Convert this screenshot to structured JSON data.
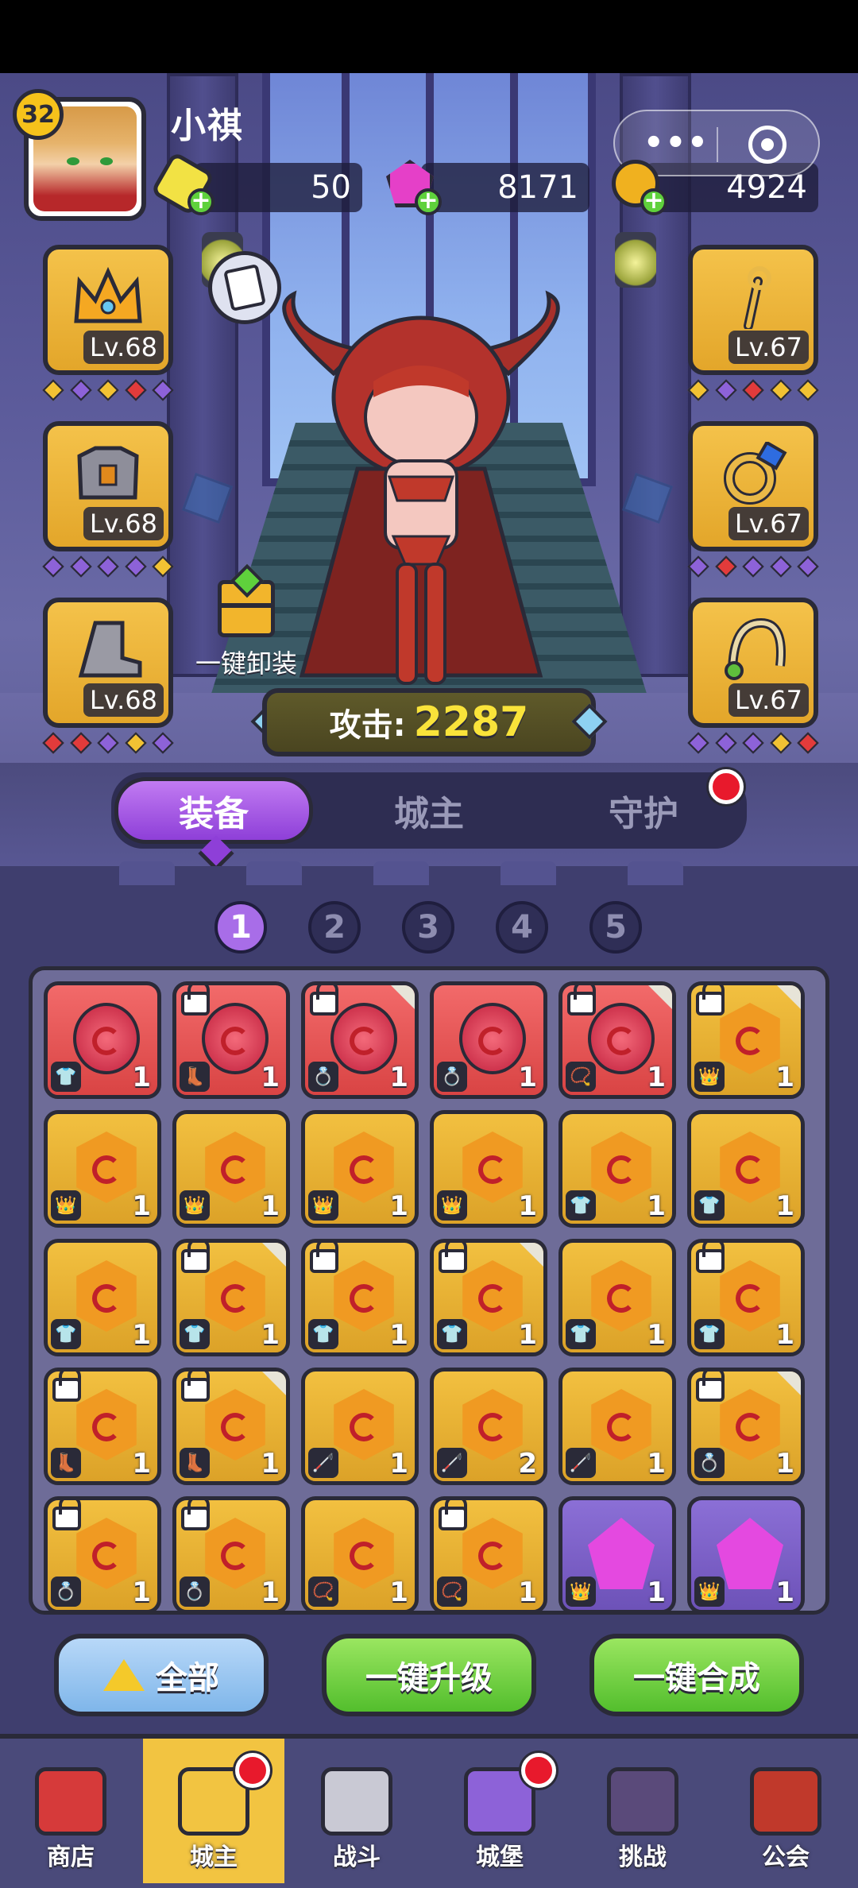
{
  "profile": {
    "level": "32",
    "name": "小祺"
  },
  "currencies": [
    {
      "icon": "gold-gem-icon",
      "value": "50",
      "color": "#f2e244"
    },
    {
      "icon": "pink-diamond-icon",
      "value": "8171",
      "color": "#e540c8"
    },
    {
      "icon": "gold-coin-icon",
      "value": "4924",
      "color": "#f0b11f"
    }
  ],
  "capsule": {
    "more": "•••"
  },
  "equipment_left": [
    {
      "name": "crown",
      "level": "Lv.68",
      "pips": [
        "#f2c233",
        "#8d62d8",
        "#f2c233",
        "#e23b3b",
        "#8d62d8"
      ]
    },
    {
      "name": "armor",
      "level": "Lv.68",
      "pips": [
        "#8d62d8",
        "#8d62d8",
        "#8d62d8",
        "#8d62d8",
        "#f2c233"
      ]
    },
    {
      "name": "boots",
      "level": "Lv.68",
      "pips": [
        "#e23b3b",
        "#e23b3b",
        "#8d62d8",
        "#f2c233",
        "#8d62d8"
      ]
    }
  ],
  "equipment_right": [
    {
      "name": "staff",
      "level": "Lv.67",
      "pips": [
        "#f2c233",
        "#8d62d8",
        "#e23b3b",
        "#f2c233",
        "#f2c233"
      ]
    },
    {
      "name": "ring",
      "level": "Lv.67",
      "pips": [
        "#8d62d8",
        "#e23b3b",
        "#8d62d8",
        "#8d62d8",
        "#8d62d8"
      ]
    },
    {
      "name": "amulet",
      "level": "Lv.67",
      "pips": [
        "#8d62d8",
        "#8d62d8",
        "#8d62d8",
        "#f2c233",
        "#e23b3b"
      ]
    }
  ],
  "unequip_label": "一键卸装",
  "attack": {
    "label": "攻击:",
    "value": "2287"
  },
  "tabs": [
    {
      "label": "装备",
      "active": true
    },
    {
      "label": "城主",
      "active": false
    },
    {
      "label": "守护",
      "active": false
    }
  ],
  "pages": [
    "1",
    "2",
    "3",
    "4",
    "5"
  ],
  "inventory": [
    [
      {
        "bg": "red",
        "gem": "round",
        "type": "👕",
        "qty": "1",
        "lock": false,
        "corner": false
      },
      {
        "bg": "red",
        "gem": "round",
        "type": "👢",
        "qty": "1",
        "lock": true,
        "corner": false
      },
      {
        "bg": "red",
        "gem": "round",
        "type": "💍",
        "qty": "1",
        "lock": true,
        "corner": true
      },
      {
        "bg": "red",
        "gem": "round",
        "type": "💍",
        "qty": "1",
        "lock": false,
        "corner": false
      },
      {
        "bg": "red",
        "gem": "round",
        "type": "📿",
        "qty": "1",
        "lock": true,
        "corner": true
      },
      {
        "bg": "gold",
        "gem": "hex",
        "type": "👑",
        "qty": "1",
        "lock": true,
        "corner": true
      }
    ],
    [
      {
        "bg": "gold",
        "gem": "hex",
        "type": "👑",
        "qty": "1",
        "lock": false,
        "corner": false
      },
      {
        "bg": "gold",
        "gem": "hex",
        "type": "👑",
        "qty": "1",
        "lock": false,
        "corner": false
      },
      {
        "bg": "gold",
        "gem": "hex",
        "type": "👑",
        "qty": "1",
        "lock": false,
        "corner": false
      },
      {
        "bg": "gold",
        "gem": "hex",
        "type": "👑",
        "qty": "1",
        "lock": false,
        "corner": false
      },
      {
        "bg": "gold",
        "gem": "hex",
        "type": "👕",
        "qty": "1",
        "lock": false,
        "corner": false
      },
      {
        "bg": "gold",
        "gem": "hex",
        "type": "👕",
        "qty": "1",
        "lock": false,
        "corner": false
      }
    ],
    [
      {
        "bg": "gold",
        "gem": "hex",
        "type": "👕",
        "qty": "1",
        "lock": false,
        "corner": false
      },
      {
        "bg": "gold",
        "gem": "hex",
        "type": "👕",
        "qty": "1",
        "lock": true,
        "corner": true
      },
      {
        "bg": "gold",
        "gem": "hex",
        "type": "👕",
        "qty": "1",
        "lock": true,
        "corner": false
      },
      {
        "bg": "gold",
        "gem": "hex",
        "type": "👕",
        "qty": "1",
        "lock": true,
        "corner": true
      },
      {
        "bg": "gold",
        "gem": "hex",
        "type": "👕",
        "qty": "1",
        "lock": false,
        "corner": false
      },
      {
        "bg": "gold",
        "gem": "hex",
        "type": "👕",
        "qty": "1",
        "lock": true,
        "corner": false
      }
    ],
    [
      {
        "bg": "gold",
        "gem": "hex",
        "type": "👢",
        "qty": "1",
        "lock": true,
        "corner": false
      },
      {
        "bg": "gold",
        "gem": "hex",
        "type": "👢",
        "qty": "1",
        "lock": true,
        "corner": true
      },
      {
        "bg": "gold",
        "gem": "hex",
        "type": "🦯",
        "qty": "1",
        "lock": false,
        "corner": false
      },
      {
        "bg": "gold",
        "gem": "hex",
        "type": "🦯",
        "qty": "2",
        "lock": false,
        "corner": false
      },
      {
        "bg": "gold",
        "gem": "hex",
        "type": "🦯",
        "qty": "1",
        "lock": false,
        "corner": false
      },
      {
        "bg": "gold",
        "gem": "hex",
        "type": "💍",
        "qty": "1",
        "lock": true,
        "corner": true
      }
    ],
    [
      {
        "bg": "gold",
        "gem": "hex",
        "type": "💍",
        "qty": "1",
        "lock": true,
        "corner": false
      },
      {
        "bg": "gold",
        "gem": "hex",
        "type": "💍",
        "qty": "1",
        "lock": true,
        "corner": false
      },
      {
        "bg": "gold",
        "gem": "hex",
        "type": "📿",
        "qty": "1",
        "lock": false,
        "corner": false
      },
      {
        "bg": "gold",
        "gem": "hex",
        "type": "📿",
        "qty": "1",
        "lock": true,
        "corner": false
      },
      {
        "bg": "purple",
        "gem": "penta",
        "type": "👑",
        "qty": "1",
        "lock": false,
        "corner": false
      },
      {
        "bg": "purple",
        "gem": "penta",
        "type": "👑",
        "qty": "1",
        "lock": false,
        "corner": false
      }
    ]
  ],
  "actions": {
    "all_label": "全部",
    "upgrade_label": "一键升级",
    "compose_label": "一键合成"
  },
  "nav": [
    {
      "label": "商店",
      "icon": "shop-icon",
      "active": false,
      "badge": false
    },
    {
      "label": "城主",
      "icon": "crown-icon",
      "active": true,
      "badge": true
    },
    {
      "label": "战斗",
      "icon": "swords-icon",
      "active": false,
      "badge": false
    },
    {
      "label": "城堡",
      "icon": "castle-icon",
      "active": false,
      "badge": true
    },
    {
      "label": "挑战",
      "icon": "demon-icon",
      "active": false,
      "badge": false
    },
    {
      "label": "公会",
      "icon": "guild-banner-icon",
      "active": false,
      "badge": false
    }
  ]
}
